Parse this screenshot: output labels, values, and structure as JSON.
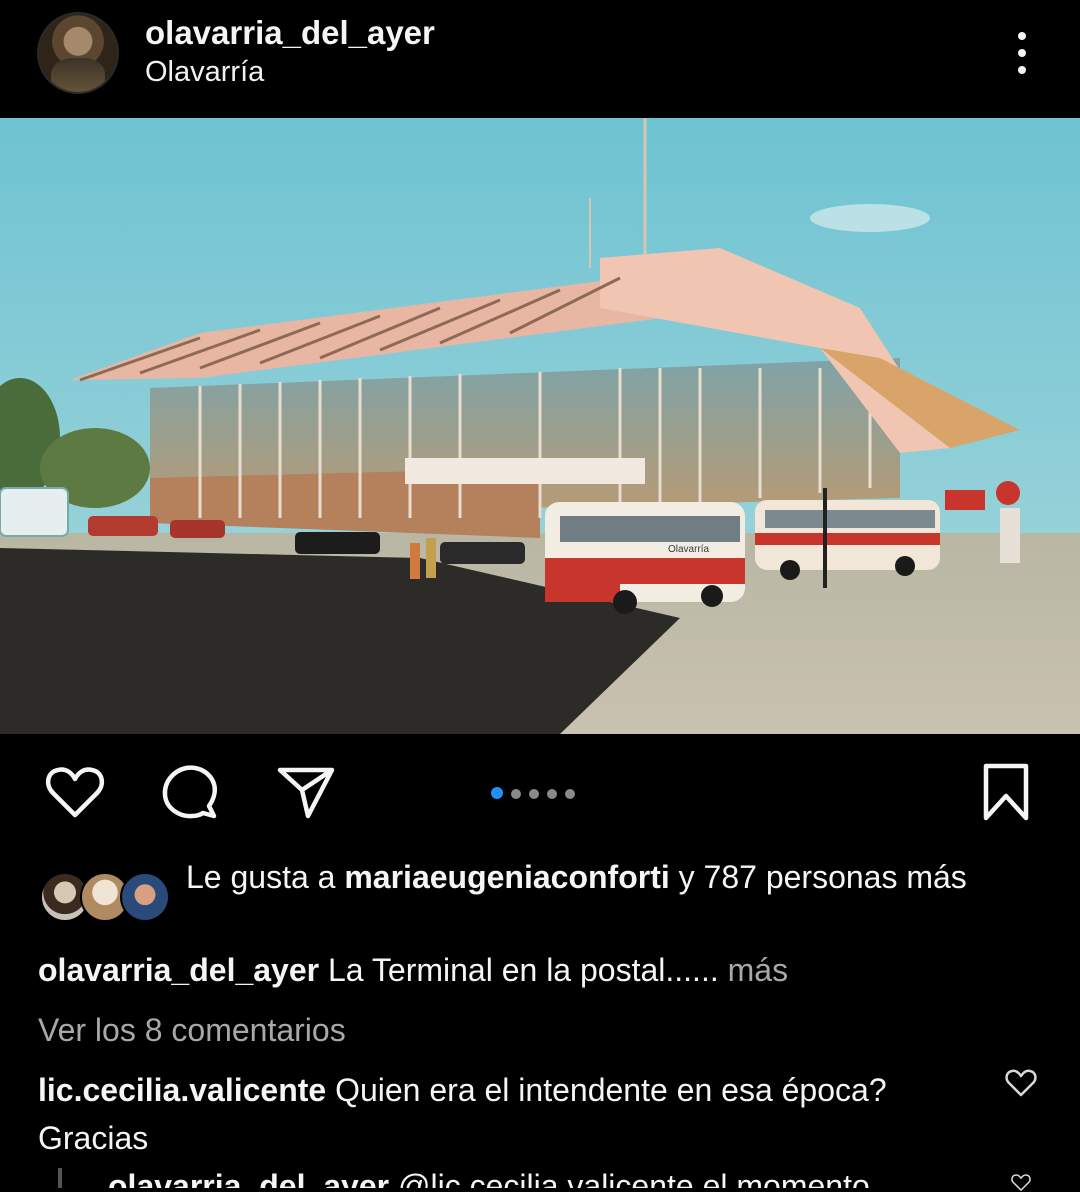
{
  "post": {
    "username": "olavarria_del_ayer",
    "location": "Olavarría",
    "carousel_count": 5,
    "carousel_active": 1
  },
  "photo": {
    "bus_sign": "Olavarría"
  },
  "likes": {
    "prefix": "Le gusta a ",
    "liker": "mariaeugeniaconforti",
    "suffix": " y 787 personas más"
  },
  "caption": {
    "username": "olavarria_del_ayer",
    "text": " La Terminal en la postal......",
    "more": " más"
  },
  "comments": {
    "view_all": "Ver los 8 comentarios",
    "first": {
      "username": "lic.cecilia.valicente",
      "text": " Quien era el intendente en esa época? Gracias"
    },
    "reply": {
      "username": "olavarria_del_ayer",
      "text": " @lic.cecilia.valicente el momento..."
    }
  },
  "colors": {
    "background": "#000000",
    "text": "#f5f5f5",
    "muted": "#a8a8a8",
    "accent_dot": "#1e90ff"
  },
  "icons": [
    "more-options-icon",
    "heart-icon",
    "comment-icon",
    "share-icon",
    "bookmark-icon"
  ]
}
